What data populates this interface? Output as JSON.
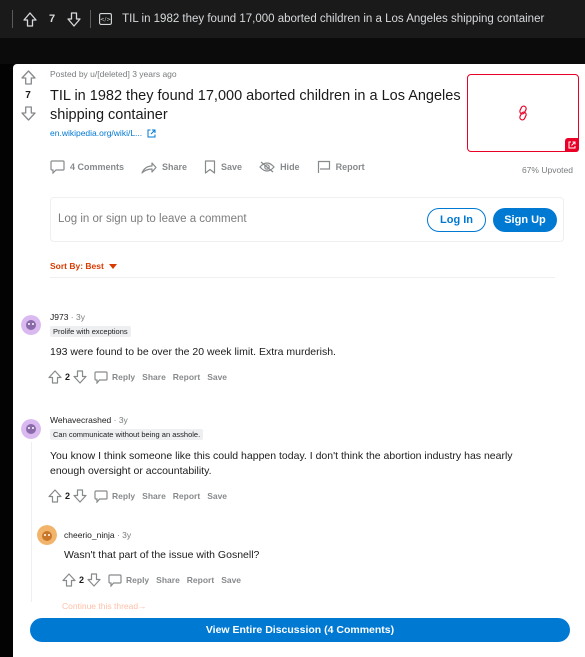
{
  "topbar": {
    "score": "7",
    "title": "TIL in 1982 they found 17,000 aborted children in a Los Angeles shipping container"
  },
  "post": {
    "score": "7",
    "meta": "Posted by u/[deleted] 3 years ago",
    "title": "TIL in 1982 they found 17,000 aborted children in a Los Angeles shipping container",
    "domain": "en.wikipedia.org/wiki/L...",
    "thumbnail_icon": "link-icon",
    "actions": {
      "comments": "4 Comments",
      "share": "Share",
      "save": "Save",
      "hide": "Hide",
      "report": "Report"
    },
    "upvoted": "67% Upvoted"
  },
  "login_box": {
    "prompt": "Log in or sign up to leave a comment",
    "login": "Log In",
    "signup": "Sign Up"
  },
  "sort": {
    "label": "Sort By: Best"
  },
  "comments": [
    {
      "author": "J973",
      "age": " · 3y",
      "flair": "Prolife with exceptions",
      "body": "193 were found to be over the 20 week limit. Extra murderish.",
      "score": "2",
      "reply": "Reply",
      "share": "Share",
      "report": "Report",
      "save": "Save"
    },
    {
      "author": "Wehavecrashed",
      "age": " · 3y",
      "flair": "Can communicate without being an asshole.",
      "body": "You know I think someone like this could happen today. I don't think the abortion industry has nearly enough oversight or accountability.",
      "score": "2",
      "reply": "Reply",
      "share": "Share",
      "report": "Report",
      "save": "Save"
    },
    {
      "author": "cheerio_ninja",
      "age": " · 3y",
      "body": "Wasn't that part of the issue with Gosnell?",
      "score": "2",
      "reply": "Reply",
      "share": "Share",
      "report": "Report",
      "save": "Save"
    }
  ],
  "continue_thread": "Continue this thread→",
  "view_all": "View Entire Discussion (4 Comments)",
  "colors": {
    "accent": "#0079d3",
    "sort": "#d93a00",
    "thumb_border": "#ea0027"
  }
}
